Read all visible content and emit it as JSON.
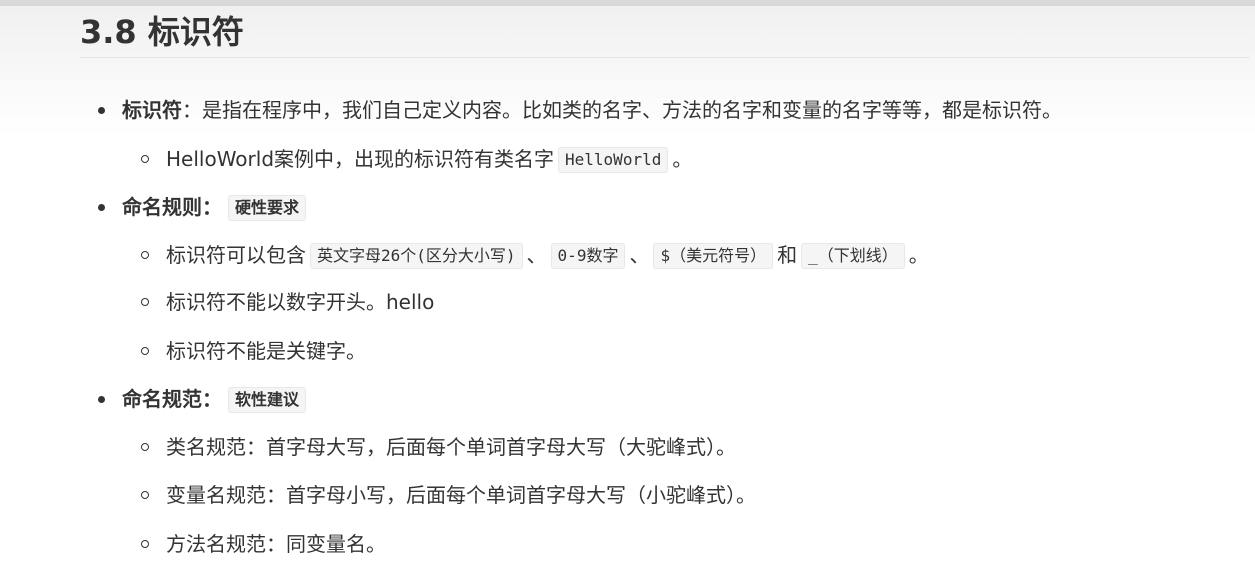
{
  "heading": "3.8 标识符",
  "items": [
    {
      "level": 1,
      "bold": "标识符",
      "text": "：是指在程序中，我们自己定义内容。比如类的名字、方法的名字和变量的名字等等，都是标识符。"
    },
    {
      "level": 2,
      "prefix": "HelloWorld案例中，出现的标识符有类名字",
      "code": "HelloWorld",
      "suffix": "。"
    },
    {
      "level": 1,
      "bold": "命名规则：",
      "tag": "硬性要求"
    },
    {
      "level": 2,
      "prefix": "标识符可以包含",
      "codes": [
        "英文字母26个(区分大小写)",
        "0-9数字",
        "$（美元符号）",
        "_（下划线）"
      ],
      "sep1": "、",
      "sep2": "、",
      "and": "和",
      "suffix": "。"
    },
    {
      "level": 2,
      "text": "标识符不能以数字开头。hello"
    },
    {
      "level": 2,
      "text": "标识符不能是关键字。"
    },
    {
      "level": 1,
      "bold": "命名规范：",
      "tag": "软性建议"
    },
    {
      "level": 2,
      "text": "类名规范：首字母大写，后面每个单词首字母大写（大驼峰式）。"
    },
    {
      "level": 2,
      "text": "变量名规范：首字母小写，后面每个单词首字母大写（小驼峰式）。"
    },
    {
      "level": 2,
      "text": "方法名规范：同变量名。"
    }
  ]
}
